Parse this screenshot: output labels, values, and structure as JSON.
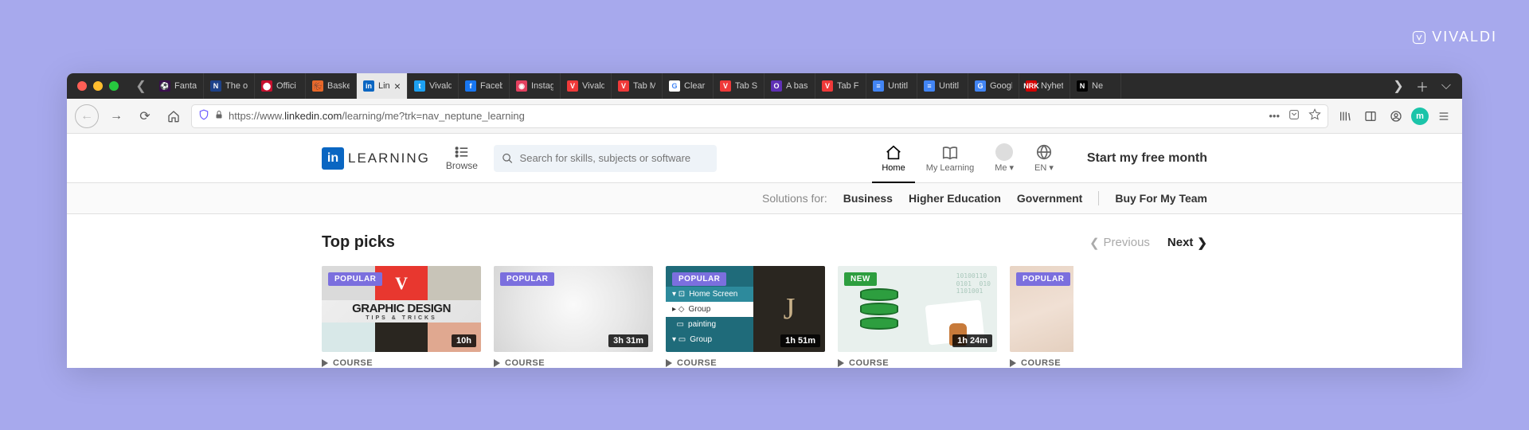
{
  "brand": "VIVALDI",
  "tabs": [
    {
      "label": "Fantas",
      "favicon_bg": "#3a0f4d",
      "favicon_char": "⚽"
    },
    {
      "label": "The of",
      "favicon_bg": "#1d428a",
      "favicon_char": "N"
    },
    {
      "label": "Offici",
      "favicon_bg": "#c8102e",
      "favicon_char": "⬤"
    },
    {
      "label": "Baske",
      "favicon_bg": "#e8682a",
      "favicon_char": "🏀"
    },
    {
      "label": "Lin",
      "favicon_bg": "#0a66c2",
      "favicon_char": "in",
      "active": true
    },
    {
      "label": "Vivald",
      "favicon_bg": "#1da1f2",
      "favicon_char": "t"
    },
    {
      "label": "Faceb",
      "favicon_bg": "#1877f2",
      "favicon_char": "f"
    },
    {
      "label": "Instag",
      "favicon_bg": "#e4405f",
      "favicon_char": "◉"
    },
    {
      "label": "Vivald",
      "favicon_bg": "#ef3939",
      "favicon_char": "V"
    },
    {
      "label": "Tab M",
      "favicon_bg": "#ef3939",
      "favicon_char": "V"
    },
    {
      "label": "Clear",
      "favicon_bg": "#ffffff",
      "favicon_char": "G"
    },
    {
      "label": "Tab St",
      "favicon_bg": "#ef3939",
      "favicon_char": "V"
    },
    {
      "label": "A bask",
      "favicon_bg": "#5f30b5",
      "favicon_char": "O"
    },
    {
      "label": "Tab Fe",
      "favicon_bg": "#ef3939",
      "favicon_char": "V"
    },
    {
      "label": "Untitl",
      "favicon_bg": "#4285f4",
      "favicon_char": "≡"
    },
    {
      "label": "Untitl",
      "favicon_bg": "#4285f4",
      "favicon_char": "≡"
    },
    {
      "label": "Googl",
      "favicon_bg": "#4285f4",
      "favicon_char": "G"
    },
    {
      "label": "Nyhet",
      "favicon_bg": "#d40000",
      "favicon_char": "NRK"
    },
    {
      "label": "Ne",
      "favicon_bg": "#000000",
      "favicon_char": "N"
    }
  ],
  "url": {
    "prefix": "https://www.",
    "host": "linkedin.com",
    "path": "/learning/me?trk=nav_neptune_learning"
  },
  "linkedin": {
    "logo_text": "LEARNING",
    "browse_label": "Browse",
    "search_placeholder": "Search for skills, subjects or software",
    "nav": [
      {
        "label": "Home",
        "active": true
      },
      {
        "label": "My Learning"
      },
      {
        "label": "Me",
        "caret": true
      },
      {
        "label": "EN",
        "caret": true
      }
    ],
    "cta": "Start my free month"
  },
  "solutions": {
    "label": "Solutions for:",
    "links": [
      "Business",
      "Higher Education",
      "Government"
    ],
    "buy": "Buy For My Team"
  },
  "section": {
    "title": "Top picks",
    "prev": "Previous",
    "next": "Next"
  },
  "cards": [
    {
      "badge": "POPULAR",
      "badge_type": "popular",
      "duration": "10h",
      "type": "COURSE"
    },
    {
      "badge": "POPULAR",
      "badge_type": "popular",
      "duration": "3h 31m",
      "type": "COURSE"
    },
    {
      "badge": "POPULAR",
      "badge_type": "popular",
      "duration": "1h 51m",
      "type": "COURSE"
    },
    {
      "badge": "NEW",
      "badge_type": "new",
      "duration": "1h 24m",
      "type": "COURSE"
    },
    {
      "badge": "POPULAR",
      "badge_type": "popular",
      "duration": "",
      "type": "COURSE"
    }
  ],
  "thumb3_items": [
    "Home Screen",
    "Group",
    "painting",
    "Group"
  ],
  "thumb1": {
    "title": "GRAPHIC DESIGN",
    "sub": "TIPS & TRICKS"
  }
}
